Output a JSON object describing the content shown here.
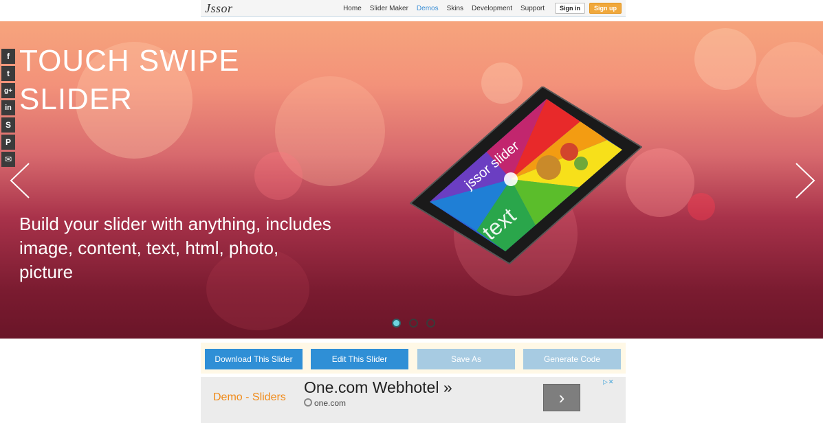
{
  "nav": {
    "logo": "Jssor",
    "items": [
      {
        "label": "Home",
        "active": false
      },
      {
        "label": "Slider Maker",
        "active": false
      },
      {
        "label": "Demos",
        "active": true
      },
      {
        "label": "Skins",
        "active": false
      },
      {
        "label": "Development",
        "active": false
      },
      {
        "label": "Support",
        "active": false
      }
    ],
    "signin": "Sign in",
    "signup": "Sign up"
  },
  "slider": {
    "headline_line1": "TOUCH SWIPE",
    "headline_line2": "SLIDER",
    "subtext": "Build your slider with anything, includes image, content, text, html, photo, picture",
    "phone_text_1": "jssor slider",
    "phone_text_2": "text",
    "dots": [
      true,
      false,
      false
    ]
  },
  "share": [
    "facebook-icon",
    "twitter-icon",
    "google-plus-icon",
    "linkedin-icon",
    "stumbleupon-icon",
    "pinterest-icon",
    "email-icon"
  ],
  "share_glyphs": [
    "f",
    "t",
    "g+",
    "in",
    "S",
    "P",
    "✉"
  ],
  "actions": {
    "download": "Download This Slider",
    "edit": "Edit This Slider",
    "save": "Save As",
    "generate": "Generate Code"
  },
  "ad": {
    "left_text": "Demo - Sliders",
    "title": "One.com Webhotel »",
    "url": "one.com",
    "go_glyph": "›"
  },
  "colors": {
    "accent": "#2f8fd6",
    "muted_button": "#a7cbe2",
    "signup": "#f0a83c",
    "ad_left": "#f08a18"
  }
}
